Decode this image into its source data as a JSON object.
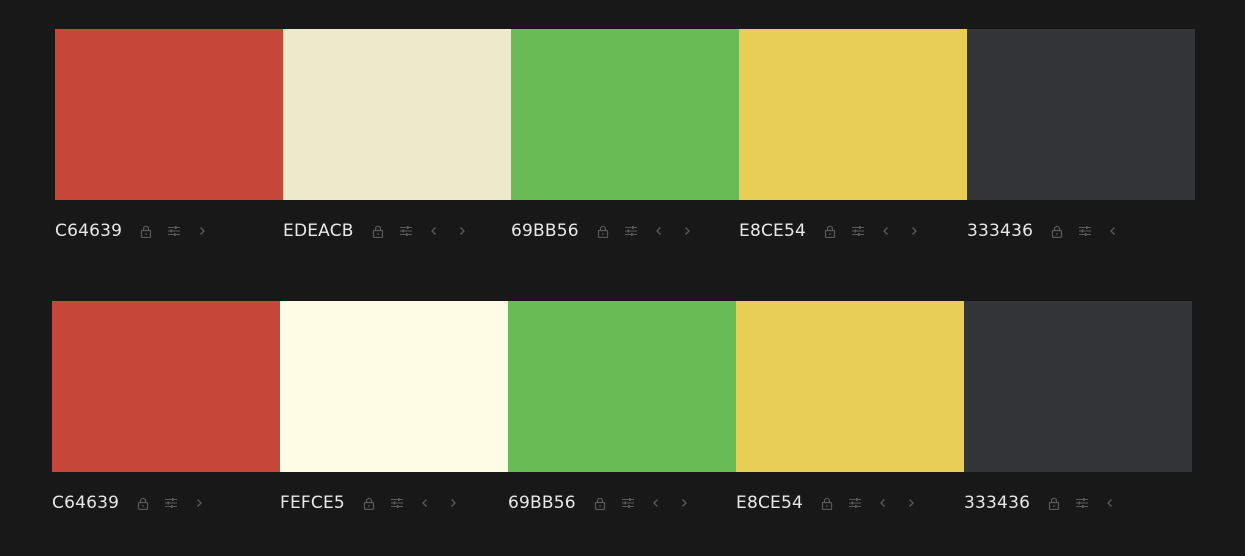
{
  "palettes": [
    {
      "colors": [
        {
          "hex": "C64639",
          "color": "#C64639",
          "has_left": false,
          "has_right": true
        },
        {
          "hex": "EDEACB",
          "color": "#EDEACB",
          "has_left": true,
          "has_right": true
        },
        {
          "hex": "69BB56",
          "color": "#69BB56",
          "has_left": true,
          "has_right": true
        },
        {
          "hex": "E8CE54",
          "color": "#E8CE54",
          "has_left": true,
          "has_right": true
        },
        {
          "hex": "333436",
          "color": "#333436",
          "has_left": true,
          "has_right": false
        }
      ]
    },
    {
      "colors": [
        {
          "hex": "C64639",
          "color": "#C64639",
          "has_left": false,
          "has_right": true
        },
        {
          "hex": "FEFCE5",
          "color": "#FEFCE5",
          "has_left": true,
          "has_right": true
        },
        {
          "hex": "69BB56",
          "color": "#69BB56",
          "has_left": true,
          "has_right": true
        },
        {
          "hex": "E8CE54",
          "color": "#E8CE54",
          "has_left": true,
          "has_right": true
        },
        {
          "hex": "333436",
          "color": "#333436",
          "has_left": true,
          "has_right": false
        }
      ]
    }
  ],
  "icons": {
    "lock": "lock-icon",
    "adjust": "sliders-icon",
    "move_left": "chevron-left-icon",
    "move_right": "chevron-right-icon"
  },
  "ui_colors": {
    "background": "#181818",
    "text": "#e8e8e8",
    "icon": "#5a5a5a"
  }
}
